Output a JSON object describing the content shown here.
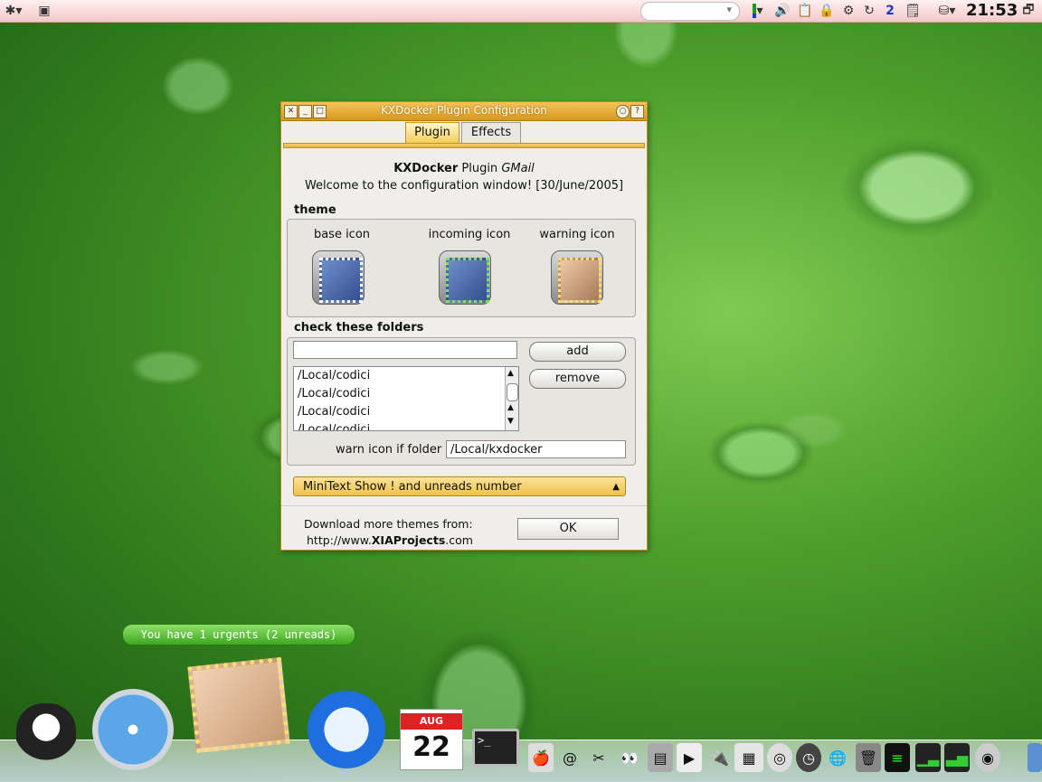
{
  "panel": {
    "clock": "21:53",
    "desktop_number": "2",
    "search_arrow": "▾"
  },
  "window": {
    "title": "KXDocker Plugin Configuration",
    "tabs": [
      {
        "label": "Plugin",
        "active": true
      },
      {
        "label": "Effects",
        "active": false
      }
    ],
    "header": {
      "brand": "KXDocker",
      "plugin_word": " Plugin ",
      "plugin_name": "GMail",
      "welcome": "Welcome to the configuration window! [30/June/2005]"
    },
    "theme": {
      "title": "theme",
      "icons": [
        {
          "label": "base icon"
        },
        {
          "label": "incoming icon"
        },
        {
          "label": "warning icon"
        }
      ]
    },
    "folders": {
      "title": "check these folders",
      "input_value": "",
      "add_label": "add",
      "remove_label": "remove",
      "list": [
        "/Local/codici",
        "/Local/codici",
        "/Local/codici",
        "/Local/codici"
      ],
      "warn_label": "warn icon if folder",
      "warn_value": "/Local/kxdocker"
    },
    "mode_select": {
      "selected": "MiniText Show ! and unreads number"
    },
    "footer": {
      "download_text": "Download more themes from:",
      "url_prefix": "http://www.",
      "url_brand": "XIAProjects",
      "url_suffix": ".com",
      "ok_label": "OK"
    }
  },
  "notification": {
    "text": "You have 1 urgents (2 unreads)"
  },
  "dock": {
    "calendar_month": "AUG",
    "calendar_day": "22",
    "terminal_prompt": ">_"
  },
  "colors": {
    "accent": "#e3a72a",
    "title_gradient_top": "#f4c45b",
    "notify_green": "#3da71f"
  }
}
